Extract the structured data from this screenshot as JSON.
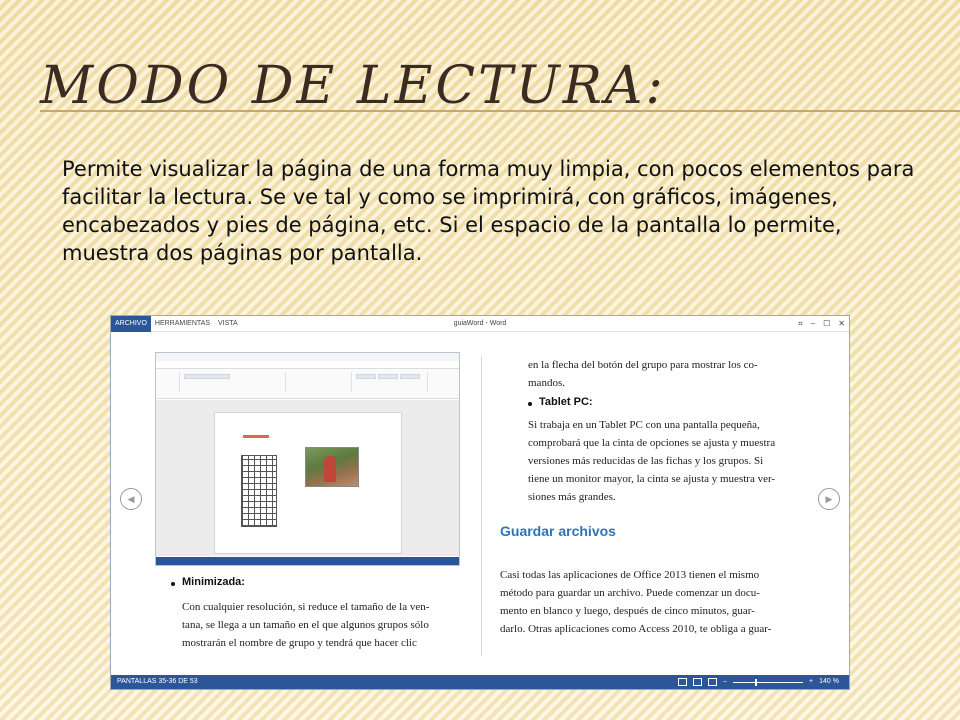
{
  "slide": {
    "title": "Modo de lectura:",
    "body": "Permite visualizar la página de una forma muy limpia, con pocos elementos para facilitar la lectura. Se ve tal y como se imprimirá, con gráficos, imágenes, encabezados y pies de página, etc. Si el espacio de la pantalla lo permite, muestra dos páginas por pantalla."
  },
  "word": {
    "menu": [
      "ARCHIVO",
      "HERRAMIENTAS",
      "VISTA"
    ],
    "title": "guiaWord - Word",
    "window_controls": [
      "⌗",
      "–",
      "☐",
      "✕"
    ],
    "left_page": {
      "bullet_title": "Minimizada:",
      "lines": [
        "Con cualquier resolución, si reduce el tamaño de la ven-",
        "tana, se llega a un tamaño en el que algunos grupos sólo",
        "mostrarán el nombre de grupo y tendrá que hacer clic"
      ]
    },
    "right_page": {
      "top_lines": [
        "en la flecha del botón del grupo para mostrar los co-",
        "mandos."
      ],
      "bullet_title": "Tablet PC:",
      "bullet_lines": [
        "Si trabaja en un Tablet PC con una pantalla pequeña,",
        "comprobará que la cinta de opciones se ajusta y muestra",
        "versiones más reducidas de las fichas y los grupos. Si",
        "tiene un monitor mayor, la cinta se ajusta y muestra ver-",
        "siones más grandes."
      ],
      "section_title": "Guardar archivos",
      "section_lines": [
        "Casi todas las aplicaciones de Office 2013 tienen el mismo",
        "método para guardar un archivo. Puede comenzar un docu-",
        "mento en blanco y luego, después de cinco minutos, guar-",
        "darlo. Otras aplicaciones como Access 2010, te obliga a guar-"
      ]
    },
    "status": {
      "pages": "PANTALLAS 35-36 DE 53",
      "zoom": "140 %"
    },
    "icons": {
      "prev": "chevron-left-icon",
      "next": "chevron-right-icon"
    }
  }
}
